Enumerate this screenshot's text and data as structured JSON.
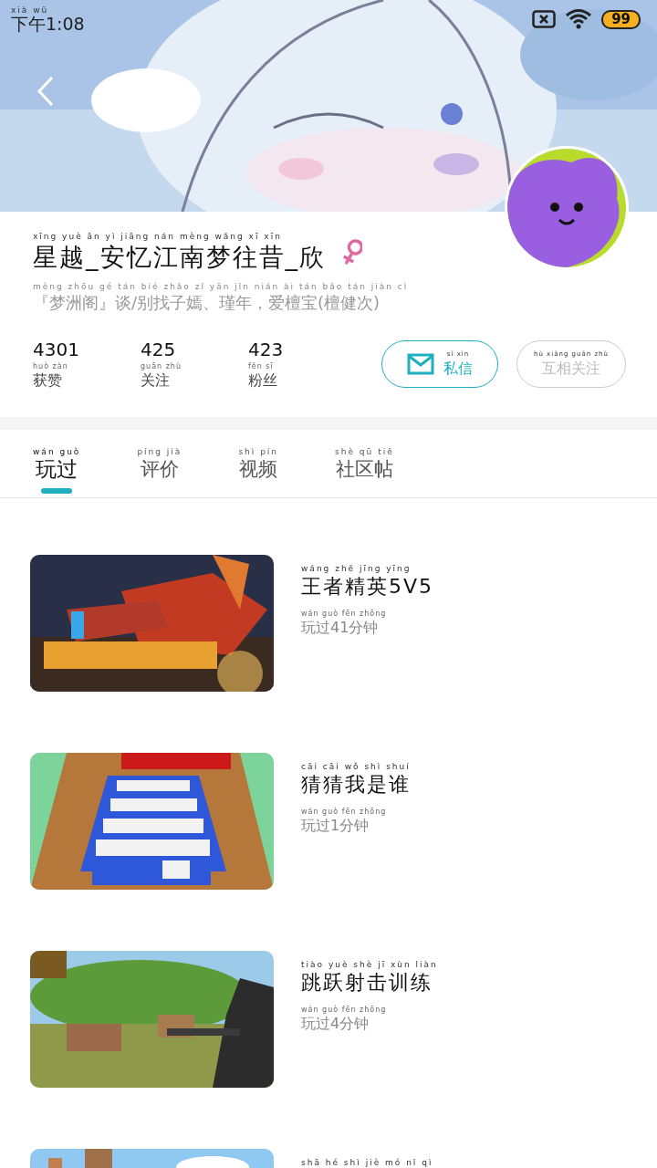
{
  "status_bar": {
    "time": "下午1:08",
    "time_pinyin": "xià wǔ",
    "battery": "99"
  },
  "profile": {
    "name": "星越_安忆江南梦往昔_欣",
    "name_pinyin": "xīng yuè ān yì jiāng nán mèng wǎng xī xīn",
    "gender": {
      "kind": "female"
    },
    "bio": "『梦洲阁』谈/别找子嫣、瑾年，爱檀宝(檀健次)",
    "bio_pinyin": "mèng zhōu gé tán bié zhǎo zǐ yān jǐn nián ài tán bǎo tán jiàn cì"
  },
  "stats": [
    {
      "value": "4301",
      "label": "获赞",
      "label_pinyin": "huò zàn"
    },
    {
      "value": "425",
      "label": "关注",
      "label_pinyin": "guān zhù"
    },
    {
      "value": "423",
      "label": "粉丝",
      "label_pinyin": "fěn sī"
    }
  ],
  "buttons": [
    {
      "kind": "message",
      "label": "私信",
      "pinyin": "sī xìn"
    },
    {
      "kind": "follow",
      "label": "互相关注",
      "pinyin": "hù xiāng guān zhù"
    }
  ],
  "tabs": [
    {
      "label": "玩过",
      "pinyin": "wán guò",
      "selected": true
    },
    {
      "label": "评价",
      "pinyin": "píng jià",
      "selected": false
    },
    {
      "label": "视频",
      "pinyin": "shì pín",
      "selected": false
    },
    {
      "label": "社区帖",
      "pinyin": "shè qū tiě",
      "selected": false
    }
  ],
  "games": [
    {
      "kind": "picture",
      "title": "王者精英5V5",
      "title_pinyin": "wáng zhě jīng yīng",
      "played": "玩过41分钟",
      "played_pinyin": "wán guò fēn zhōng"
    },
    {
      "kind": "picture",
      "title": "猜猜我是谁",
      "title_pinyin": "cāi cāi wǒ shì shuí",
      "played": "玩过1分钟",
      "played_pinyin": "wán guò fēn zhōng"
    },
    {
      "kind": "picture",
      "title": "跳跃射击训练",
      "title_pinyin": "tiào yuè shè jī xùn liàn",
      "played": "玩过4分钟",
      "played_pinyin": "wán guò fēn zhōng"
    },
    {
      "kind": "picture",
      "title_pinyin": "shā hé shì jiè mó nǐ qì"
    }
  ]
}
